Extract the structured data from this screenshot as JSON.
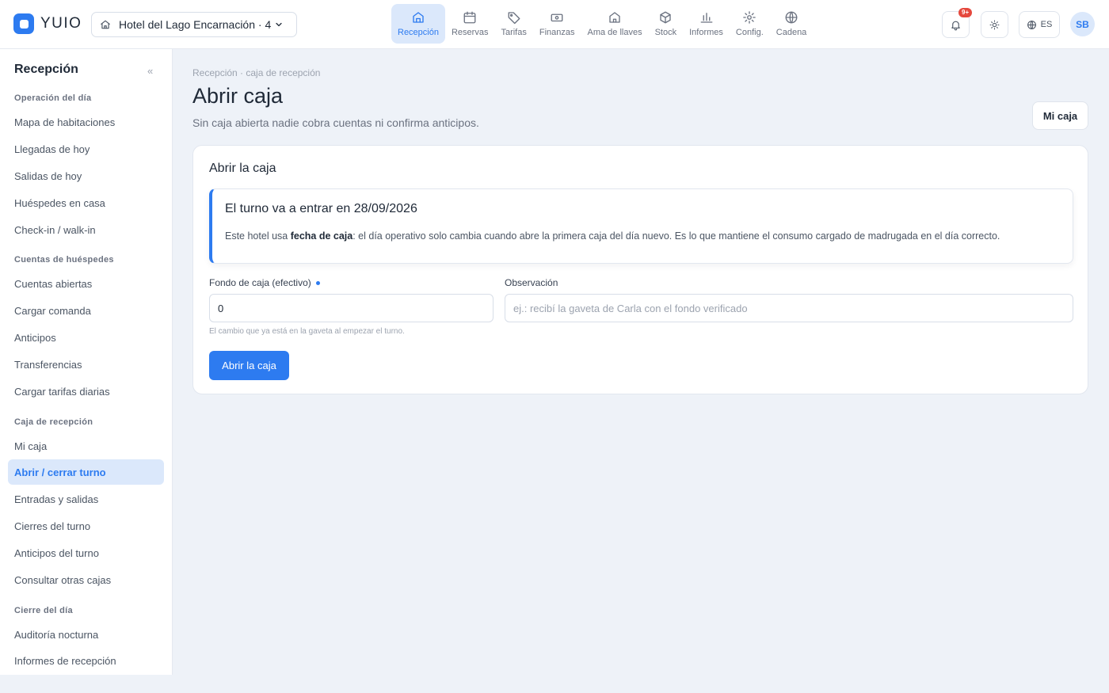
{
  "brand": {
    "name": "YUIO"
  },
  "hotel_selector": {
    "name": "Hotel del Lago Encarnación · 4"
  },
  "nav": [
    {
      "label": "Recepción",
      "icon": "reception-icon",
      "active": true
    },
    {
      "label": "Reservas",
      "icon": "calendar-icon"
    },
    {
      "label": "Tarifas",
      "icon": "tag-icon"
    },
    {
      "label": "Finanzas",
      "icon": "cash-icon"
    },
    {
      "label": "Ama de llaves",
      "icon": "house-icon"
    },
    {
      "label": "Stock",
      "icon": "box-icon"
    },
    {
      "label": "Informes",
      "icon": "bar-chart-icon"
    },
    {
      "label": "Config.",
      "icon": "gear-icon"
    },
    {
      "label": "Cadena",
      "icon": "globe-icon"
    }
  ],
  "topbar": {
    "notifications_badge": "9+",
    "language": "ES",
    "avatar_initials": "SB"
  },
  "sidebar": {
    "title": "Recepción",
    "collapse_icon": "«",
    "sections": [
      {
        "label": "Operación del día",
        "items": [
          "Mapa de habitaciones",
          "Llegadas de hoy",
          "Salidas de hoy",
          "Huéspedes en casa",
          "Check-in / walk-in"
        ]
      },
      {
        "label": "Cuentas de huéspedes",
        "items": [
          "Cuentas abiertas",
          "Cargar comanda",
          "Anticipos",
          "Transferencias",
          "Cargar tarifas diarias"
        ]
      },
      {
        "label": "Caja de recepción",
        "items": [
          "Mi caja",
          "Abrir / cerrar turno",
          "Entradas y salidas",
          "Cierres del turno",
          "Anticipos del turno",
          "Consultar otras cajas"
        ]
      },
      {
        "label": "Cierre del día",
        "items": [
          "Auditoría nocturna",
          "Informes de recepción"
        ]
      }
    ],
    "active_item": "Abrir / cerrar turno"
  },
  "page": {
    "breadcrumb": "Recepción · caja de recepción",
    "title": "Abrir caja",
    "subtitle": "Sin caja abierta nadie cobra cuentas ni confirma anticipos.",
    "my_box_button": "Mi caja"
  },
  "card": {
    "title": "Abrir la caja",
    "notice": {
      "title": "El turno va a entrar en 28/09/2026",
      "text_before": "Este hotel usa ",
      "text_bold": "fecha de caja",
      "text_after": ": el día operativo solo cambia cuando abre la primera caja del día nuevo. Es lo que mantiene el consumo cargado de madrugada en el día correcto."
    },
    "fund_label": "Fondo de caja (efectivo)",
    "fund_value": "0",
    "fund_hint": "El cambio que ya está en la gaveta al empezar el turno.",
    "note_label": "Observación",
    "note_placeholder": "ej.: recibí la gaveta de Carla con el fondo verificado",
    "submit_label": "Abrir la caja"
  },
  "colors": {
    "accent": "#2d7bf0",
    "accent_soft": "#dbe8fb",
    "background": "#eef2f8",
    "badge": "#e5483d"
  }
}
